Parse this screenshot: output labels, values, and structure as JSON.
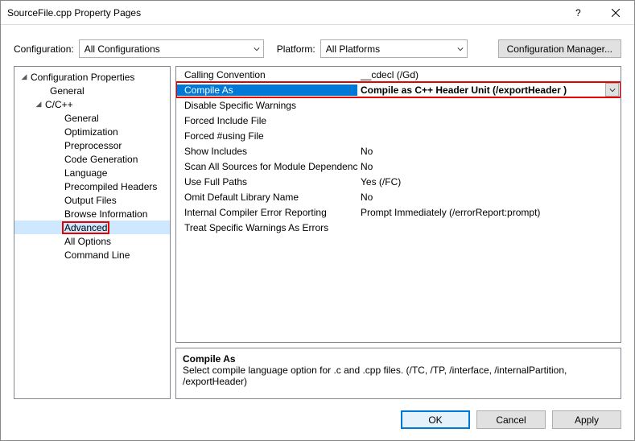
{
  "title": "SourceFile.cpp Property Pages",
  "config": {
    "label": "Configuration:",
    "value": "All Configurations",
    "platform_label": "Platform:",
    "platform_value": "All Platforms",
    "manager": "Configuration Manager..."
  },
  "tree": {
    "root": "Configuration Properties",
    "general_root": "General",
    "cxx": "C/C++",
    "items": {
      "general": "General",
      "optimization": "Optimization",
      "preprocessor": "Preprocessor",
      "codegen": "Code Generation",
      "language": "Language",
      "pch": "Precompiled Headers",
      "output": "Output Files",
      "browse": "Browse Information",
      "advanced": "Advanced",
      "alloptions": "All Options",
      "cmdline": "Command Line"
    }
  },
  "props": {
    "calling_convention": {
      "name": "Calling Convention",
      "value": "__cdecl (/Gd)"
    },
    "compile_as": {
      "name": "Compile As",
      "value": "Compile as C++ Header Unit (/exportHeader )"
    },
    "disable_warnings": {
      "name": "Disable Specific Warnings",
      "value": ""
    },
    "forced_include": {
      "name": "Forced Include File",
      "value": ""
    },
    "forced_using": {
      "name": "Forced #using File",
      "value": ""
    },
    "show_includes": {
      "name": "Show Includes",
      "value": "No"
    },
    "scan_sources": {
      "name": "Scan All Sources for Module Dependencies",
      "value": "No"
    },
    "use_full_paths": {
      "name": "Use Full Paths",
      "value": "Yes (/FC)"
    },
    "omit_default_lib": {
      "name": "Omit Default Library Name",
      "value": "No"
    },
    "ice_reporting": {
      "name": "Internal Compiler Error Reporting",
      "value": "Prompt Immediately (/errorReport:prompt)"
    },
    "treat_warnings": {
      "name": "Treat Specific Warnings As Errors",
      "value": ""
    }
  },
  "help": {
    "title": "Compile As",
    "text": "Select compile language option for .c and .cpp files.     (/TC, /TP, /interface, /internalPartition, /exportHeader)"
  },
  "buttons": {
    "ok": "OK",
    "cancel": "Cancel",
    "apply": "Apply"
  }
}
